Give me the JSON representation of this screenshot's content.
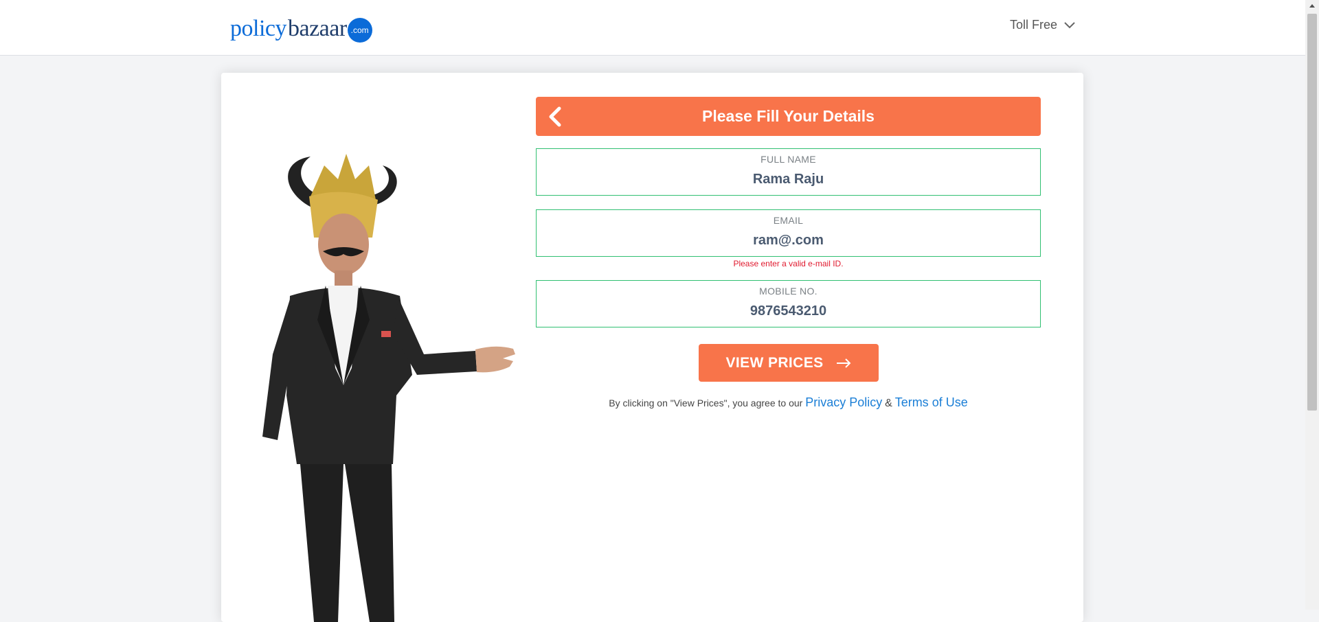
{
  "header": {
    "logo_left": "policy",
    "logo_right": "bazaar",
    "logo_dot": ".com",
    "toll_free": "Toll Free"
  },
  "form": {
    "title": "Please Fill Your Details",
    "full_name": {
      "label": "FULL NAME",
      "value": "Rama Raju"
    },
    "email": {
      "label": "EMAIL",
      "value": "ram@.com",
      "error": "Please enter a valid e-mail ID."
    },
    "mobile": {
      "label": "MOBILE NO.",
      "value": "9876543210"
    },
    "submit_label": "VIEW PRICES",
    "terms_prefix": "By clicking on \"View Prices\", you agree to our",
    "privacy_link": "Privacy Policy",
    "ampersand": "&",
    "terms_link": "Terms of Use"
  },
  "colors": {
    "accent": "#f8744a",
    "field_border": "#2fbf71",
    "error": "#e0182d",
    "link": "#1a7ed6",
    "brand_blue": "#0b6bd8"
  },
  "icons": [
    "chevron-down-icon",
    "back-arrow-icon",
    "right-arrow-icon"
  ]
}
